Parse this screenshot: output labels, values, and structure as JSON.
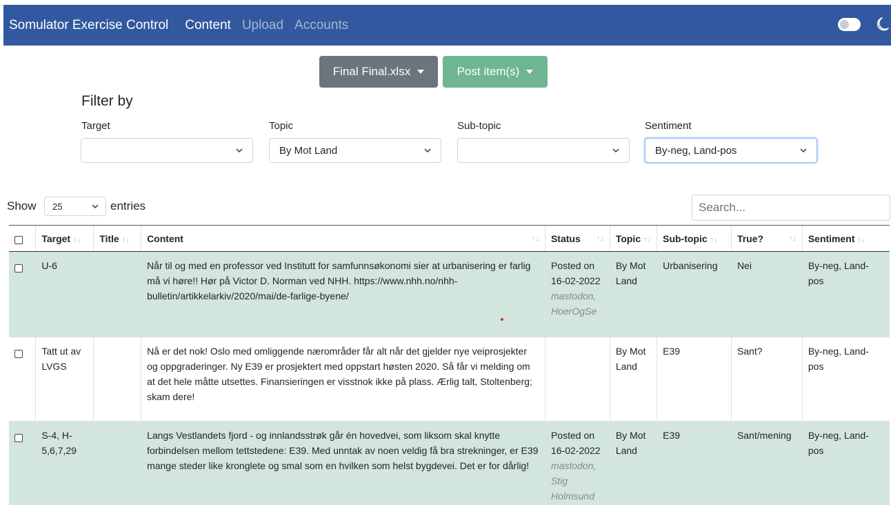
{
  "navbar": {
    "brand": "Somulator Exercise Control",
    "links": [
      "Content",
      "Upload",
      "Accounts"
    ]
  },
  "toolbar": {
    "file_button": "Final Final.xlsx",
    "post_button": "Post item(s)"
  },
  "filters": {
    "title": "Filter by",
    "target": {
      "label": "Target",
      "value": ""
    },
    "topic": {
      "label": "Topic",
      "value": "By Mot Land"
    },
    "subtopic": {
      "label": "Sub-topic",
      "value": ""
    },
    "sentiment": {
      "label": "Sentiment",
      "value": "By-neg, Land-pos"
    }
  },
  "table_controls": {
    "show_label": "Show",
    "page_length": "25",
    "entries_label": "entries",
    "search_placeholder": "Search..."
  },
  "columns": [
    "Target",
    "Title",
    "Content",
    "Status",
    "Topic",
    "Sub-topic",
    "True?",
    "Sentiment"
  ],
  "rows": [
    {
      "target": "U-6",
      "title": "",
      "content": "Når til og med en professor ved Institutt for samfunnsøkonomi sier at urbanisering er farlig må vi høre!! Hør på Victor D. Norman ved NHH. https://www.nhh.no/nhh-bulletin/artikkelarkiv/2020/mai/de-farlige-byene/",
      "status_main": "Posted on 16-02-2022",
      "status_sub": "mastodon, HoerOgSe",
      "topic": "By Mot Land",
      "subtopic": "Urbanisering",
      "true": "Nei",
      "sentiment": "By-neg, Land-pos"
    },
    {
      "target": "Tatt ut av LVGS",
      "title": "",
      "content": "Nå er det nok! Oslo med omliggende nærområder får alt når det gjelder nye veiprosjekter og oppgraderinger. Ny E39 er prosjektert med oppstart høsten 2020. Så får vi melding om at det hele måtte utsettes. Finansieringen er visstnok ikke på plass. Ærlig talt, Stoltenberg; skam dere!",
      "status_main": "",
      "status_sub": "",
      "topic": "By Mot Land",
      "subtopic": "E39",
      "true": "Sant?",
      "sentiment": "By-neg, Land-pos"
    },
    {
      "target": "S-4, H-5,6,7,29",
      "title": "",
      "content": "Langs Vestlandets fjord - og innlandsstrøk går én hovedvei, som liksom skal knytte forbindelsen mellom tettstedene: E39. Med unntak av noen veldig få bra strekninger, er E39 mange steder like kronglete og smal som en hvilken som helst bygdevei. Det er for dårlig!",
      "status_main": "Posted on 16-02-2022",
      "status_sub": "mastodon, Stig Holmsund",
      "topic": "By Mot Land",
      "subtopic": "E39",
      "true": "Sant/mening",
      "sentiment": "By-neg, Land-pos"
    }
  ]
}
